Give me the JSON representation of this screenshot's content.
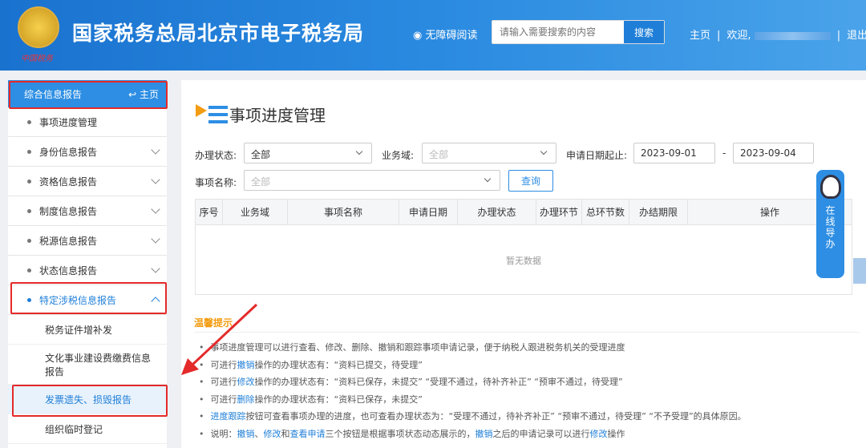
{
  "header": {
    "title": "国家税务总局北京市电子税务局",
    "emblem_text": "中国税务",
    "accessibility": "无障碍阅读",
    "search_placeholder": "请输入需要搜索的内容",
    "search_button": "搜索",
    "home": "主页",
    "welcome": "欢迎,",
    "logout": "退出",
    "sep": "|"
  },
  "sidebar": {
    "head": "综合信息报告",
    "home": "主页",
    "items": [
      "事项进度管理",
      "身份信息报告",
      "资格信息报告",
      "制度信息报告",
      "税源信息报告",
      "状态信息报告",
      "特定涉税信息报告"
    ],
    "subitems": [
      "税务证件增补发",
      "文化事业建设费缴费信息报告",
      "发票遗失、损毁报告",
      "组织临时登记"
    ]
  },
  "main": {
    "title": "事项进度管理",
    "filters": {
      "status_label": "办理状态:",
      "status_value": "全部",
      "domain_label": "业务域:",
      "domain_placeholder": "全部",
      "date_label": "申请日期起止:",
      "date_from": "2023-09-01",
      "date_dash": "-",
      "date_to": "2023-09-04",
      "name_label": "事项名称:",
      "name_placeholder": "全部",
      "query": "查询"
    },
    "table": {
      "columns": [
        "序号",
        "业务域",
        "事项名称",
        "申请日期",
        "办理状态",
        "办理环节",
        "总环节数",
        "办结期限",
        "操作"
      ],
      "empty": "暂无数据"
    },
    "tips": {
      "title": "温馨提示",
      "l1": "事项进度管理可以进行查看、修改、删除、撤销和跟踪事项申请记录，便于纳税人跟进税务机关的受理进度",
      "l2a": "可进行",
      "l2b": "撤销",
      "l2c": "操作的办理状态有：“资料已提交，待受理”",
      "l3a": "可进行",
      "l3b": "修改",
      "l3c": "操作的办理状态有：“资料已保存，未提交”  “受理不通过，待补齐补正”  “预审不通过，待受理”",
      "l4a": "可进行",
      "l4b": "删除",
      "l4c": "操作的办理状态有：“资料已保存，未提交”",
      "l5a": "进度跟踪",
      "l5b": "按钮可查看事项办理的进度，也可查看办理状态为：“受理不通过，待补齐补正”  “预审不通过，待受理”  “不予受理”的具体原因。",
      "l6a": "说明：",
      "l6b": "撤销",
      "l6c": "、",
      "l6d": "修改",
      "l6e": "和",
      "l6f": "查看申请",
      "l6g": "三个按钮是根据事项状态动态展示的，",
      "l6h": "撤销",
      "l6i": "之后的申请记录可以进行",
      "l6j": "修改",
      "l6k": "操作"
    }
  },
  "widget": {
    "label": "在线导办"
  }
}
